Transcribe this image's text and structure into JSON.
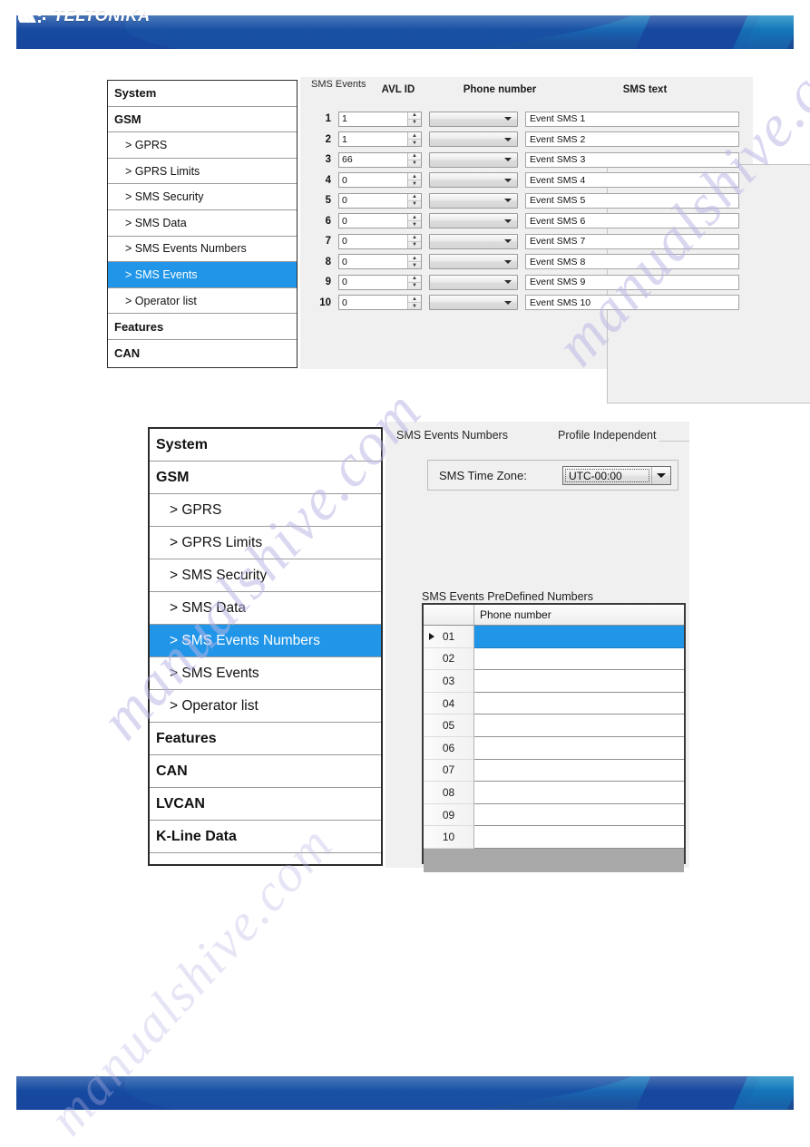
{
  "brand": {
    "name": "TELTONIKA",
    "logo_icon": "teltonika-chevrons-icon",
    "header_color": "#1577bd",
    "accent_color": "#2196e8"
  },
  "watermark": {
    "text_1": "manualshive.com",
    "text_2": "manualshive.com",
    "text_3": "manualshive.com"
  },
  "figure1": {
    "sidebar": {
      "items": [
        {
          "label": "System",
          "level": "top",
          "selected": false
        },
        {
          "label": "GSM",
          "level": "top",
          "selected": false
        },
        {
          "label": "> GPRS",
          "level": "child",
          "selected": false
        },
        {
          "label": "> GPRS Limits",
          "level": "child",
          "selected": false
        },
        {
          "label": "> SMS Security",
          "level": "child",
          "selected": false
        },
        {
          "label": "> SMS Data",
          "level": "child",
          "selected": false
        },
        {
          "label": "> SMS Events Numbers",
          "level": "child",
          "selected": false
        },
        {
          "label": "> SMS Events",
          "level": "child",
          "selected": true
        },
        {
          "label": "> Operator list",
          "level": "child",
          "selected": false
        },
        {
          "label": "Features",
          "level": "top",
          "selected": false
        },
        {
          "label": "CAN",
          "level": "top",
          "selected": false
        }
      ]
    },
    "groupbox_label": "SMS Events",
    "columns": {
      "avl_id": "AVL ID",
      "phone_number": "Phone number",
      "sms_text": "SMS text"
    },
    "rows": [
      {
        "index": "1",
        "avl_id": "1",
        "phone_number": "",
        "sms_text": "Event SMS 1"
      },
      {
        "index": "2",
        "avl_id": "1",
        "phone_number": "",
        "sms_text": "Event SMS 2"
      },
      {
        "index": "3",
        "avl_id": "66",
        "phone_number": "",
        "sms_text": "Event SMS 3"
      },
      {
        "index": "4",
        "avl_id": "0",
        "phone_number": "",
        "sms_text": "Event SMS 4"
      },
      {
        "index": "5",
        "avl_id": "0",
        "phone_number": "",
        "sms_text": "Event SMS 5"
      },
      {
        "index": "6",
        "avl_id": "0",
        "phone_number": "",
        "sms_text": "Event SMS 6"
      },
      {
        "index": "7",
        "avl_id": "0",
        "phone_number": "",
        "sms_text": "Event SMS 7"
      },
      {
        "index": "8",
        "avl_id": "0",
        "phone_number": "",
        "sms_text": "Event SMS 8"
      },
      {
        "index": "9",
        "avl_id": "0",
        "phone_number": "",
        "sms_text": "Event SMS 9"
      },
      {
        "index": "10",
        "avl_id": "0",
        "phone_number": "",
        "sms_text": "Event SMS 10"
      }
    ]
  },
  "figure2": {
    "sidebar": {
      "items": [
        {
          "label": "System",
          "level": "top",
          "selected": false
        },
        {
          "label": "GSM",
          "level": "top",
          "selected": false
        },
        {
          "label": "> GPRS",
          "level": "child",
          "selected": false
        },
        {
          "label": "> GPRS Limits",
          "level": "child",
          "selected": false
        },
        {
          "label": "> SMS Security",
          "level": "child",
          "selected": false
        },
        {
          "label": "> SMS Data",
          "level": "child",
          "selected": false
        },
        {
          "label": "> SMS Events Numbers",
          "level": "child",
          "selected": true
        },
        {
          "label": "> SMS Events",
          "level": "child",
          "selected": false
        },
        {
          "label": "> Operator list",
          "level": "child",
          "selected": false
        },
        {
          "label": "Features",
          "level": "top",
          "selected": false
        },
        {
          "label": "CAN",
          "level": "top",
          "selected": false
        },
        {
          "label": "LVCAN",
          "level": "top",
          "selected": false
        },
        {
          "label": "K-Line Data",
          "level": "top",
          "selected": false
        }
      ]
    },
    "section_title": "SMS Events Numbers",
    "profile_scope": "Profile Independent",
    "time_zone": {
      "label": "SMS Time Zone:",
      "value": "UTC-00:00"
    },
    "predefined": {
      "title": "SMS Events PreDefined Numbers",
      "column_header": "Phone number",
      "rows": [
        {
          "index": "01",
          "phone_number": "",
          "selected": true
        },
        {
          "index": "02",
          "phone_number": "",
          "selected": false
        },
        {
          "index": "03",
          "phone_number": "",
          "selected": false
        },
        {
          "index": "04",
          "phone_number": "",
          "selected": false
        },
        {
          "index": "05",
          "phone_number": "",
          "selected": false
        },
        {
          "index": "06",
          "phone_number": "",
          "selected": false
        },
        {
          "index": "07",
          "phone_number": "",
          "selected": false
        },
        {
          "index": "08",
          "phone_number": "",
          "selected": false
        },
        {
          "index": "09",
          "phone_number": "",
          "selected": false
        },
        {
          "index": "10",
          "phone_number": "",
          "selected": false
        }
      ]
    }
  }
}
